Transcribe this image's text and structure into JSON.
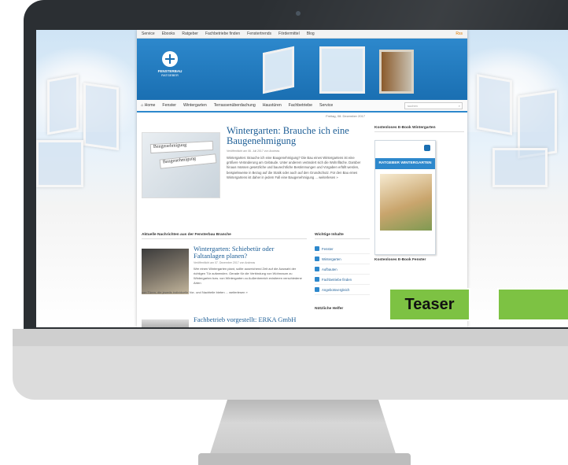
{
  "site": {
    "topbar": [
      "Service",
      "Ebooks",
      "Ratgeber",
      "Fachbetriebe finden",
      "Fenstertrends",
      "Fördermittel",
      "Blog"
    ],
    "rss": "Rss",
    "logo": {
      "line1": "FENSTERBAU",
      "line2": "RATGEBER"
    },
    "nav": [
      "⌂ Home",
      "Fenster",
      "Wintergarten",
      "Terrassenüberdachung",
      "Haustüren",
      "Fachbetriebe",
      "Service"
    ],
    "search_placeholder": "suchen",
    "date": "Freitag, 08. Dezember 2017"
  },
  "featured": {
    "binder1": "Baugenehmigung",
    "binder2": "Baugenehmigung",
    "title": "Wintergarten: Brauche ich eine Baugenehmigung",
    "meta": "Veröffentlicht am 08. Juli 2017 von Andreas",
    "text": "Wintergarten: Brauche ich eine Baugenehmigung? Die Bau eines Wintergartens ist eine größere Veränderung am Gebäude. Unter anderem verändert sich die Wohnfläche. Darüber hinaus müssen gesetzliche und baurechtliche Bestimmungen und Vorgaben erfüllt werden, beispielsweise in Bezug auf die Statik oder auch auf den Grundschutz. Für den Bau eines Wintergartens ist daher in jedem Fall eine Baugenehmigung ... weiterlesen »"
  },
  "sidebar": {
    "ebook_heading": "Kostenloses E-Book Wintergarten",
    "ebook_title": "RATGEBER WINTERGARTEN",
    "ebook2_heading": "Kostenloses E-Book Fenster",
    "quick_heading": "Wichtige Inhalte",
    "quick_items": [
      "Fenster",
      "Wintergarten",
      "Aufbauten",
      "Fachbetriebe finden",
      "Angebotsvergleich"
    ],
    "tools_heading": "Nützliche Helfer"
  },
  "news": {
    "heading": "Aktuelle Nachrichten aus der Fensterbau Branche",
    "article1": {
      "title": "Wintergarten: Schiebetür oder Faltanlagen planen?",
      "meta": "Veröffentlicht am 07. Dezember 2017 von Andreas",
      "text": "Wer einen Wintergarten plant, sollte ausreichend Zeit auf die Auswahl der richtigen Tür aufwenden. Gerade für die Verbindung von Wohnraum zu Wintergarten bzw. von Wintergarten zu Außenbereich existieren verschiedene Arten",
      "text2": "von Türen, die jeweils individuelle Vor- und Nachteile bieten ... weiterlesen »"
    },
    "article2": {
      "title": "Fachbetrieb vorgestellt: ERKA GmbH"
    }
  },
  "teaser": {
    "label": "Teaser"
  }
}
